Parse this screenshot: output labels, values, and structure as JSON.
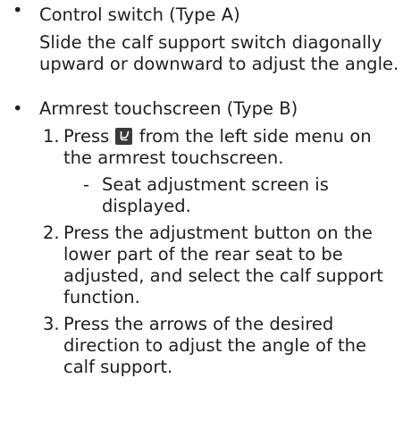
{
  "section_a": {
    "bullet": "•",
    "heading": "Control switch (Type A)",
    "body": "Slide the calf support switch diagonally upward or downward to adjust the angle."
  },
  "section_b": {
    "bullet": "•",
    "heading": "Armrest touchscreen (Type B)",
    "steps": [
      {
        "num": "1.",
        "before_icon": "Press",
        "icon": "seat-icon",
        "after_icon": " from the left side menu on the armrest touchscreen.",
        "sub_dash": "-",
        "sub": "Seat adjustment screen is displayed."
      },
      {
        "num": "2.",
        "text": "Press the adjustment button on the lower part of the rear seat to be adjusted, and select the calf support function."
      },
      {
        "num": "3.",
        "text": "Press the arrows of the desired direction to adjust the angle of the calf support."
      }
    ]
  }
}
